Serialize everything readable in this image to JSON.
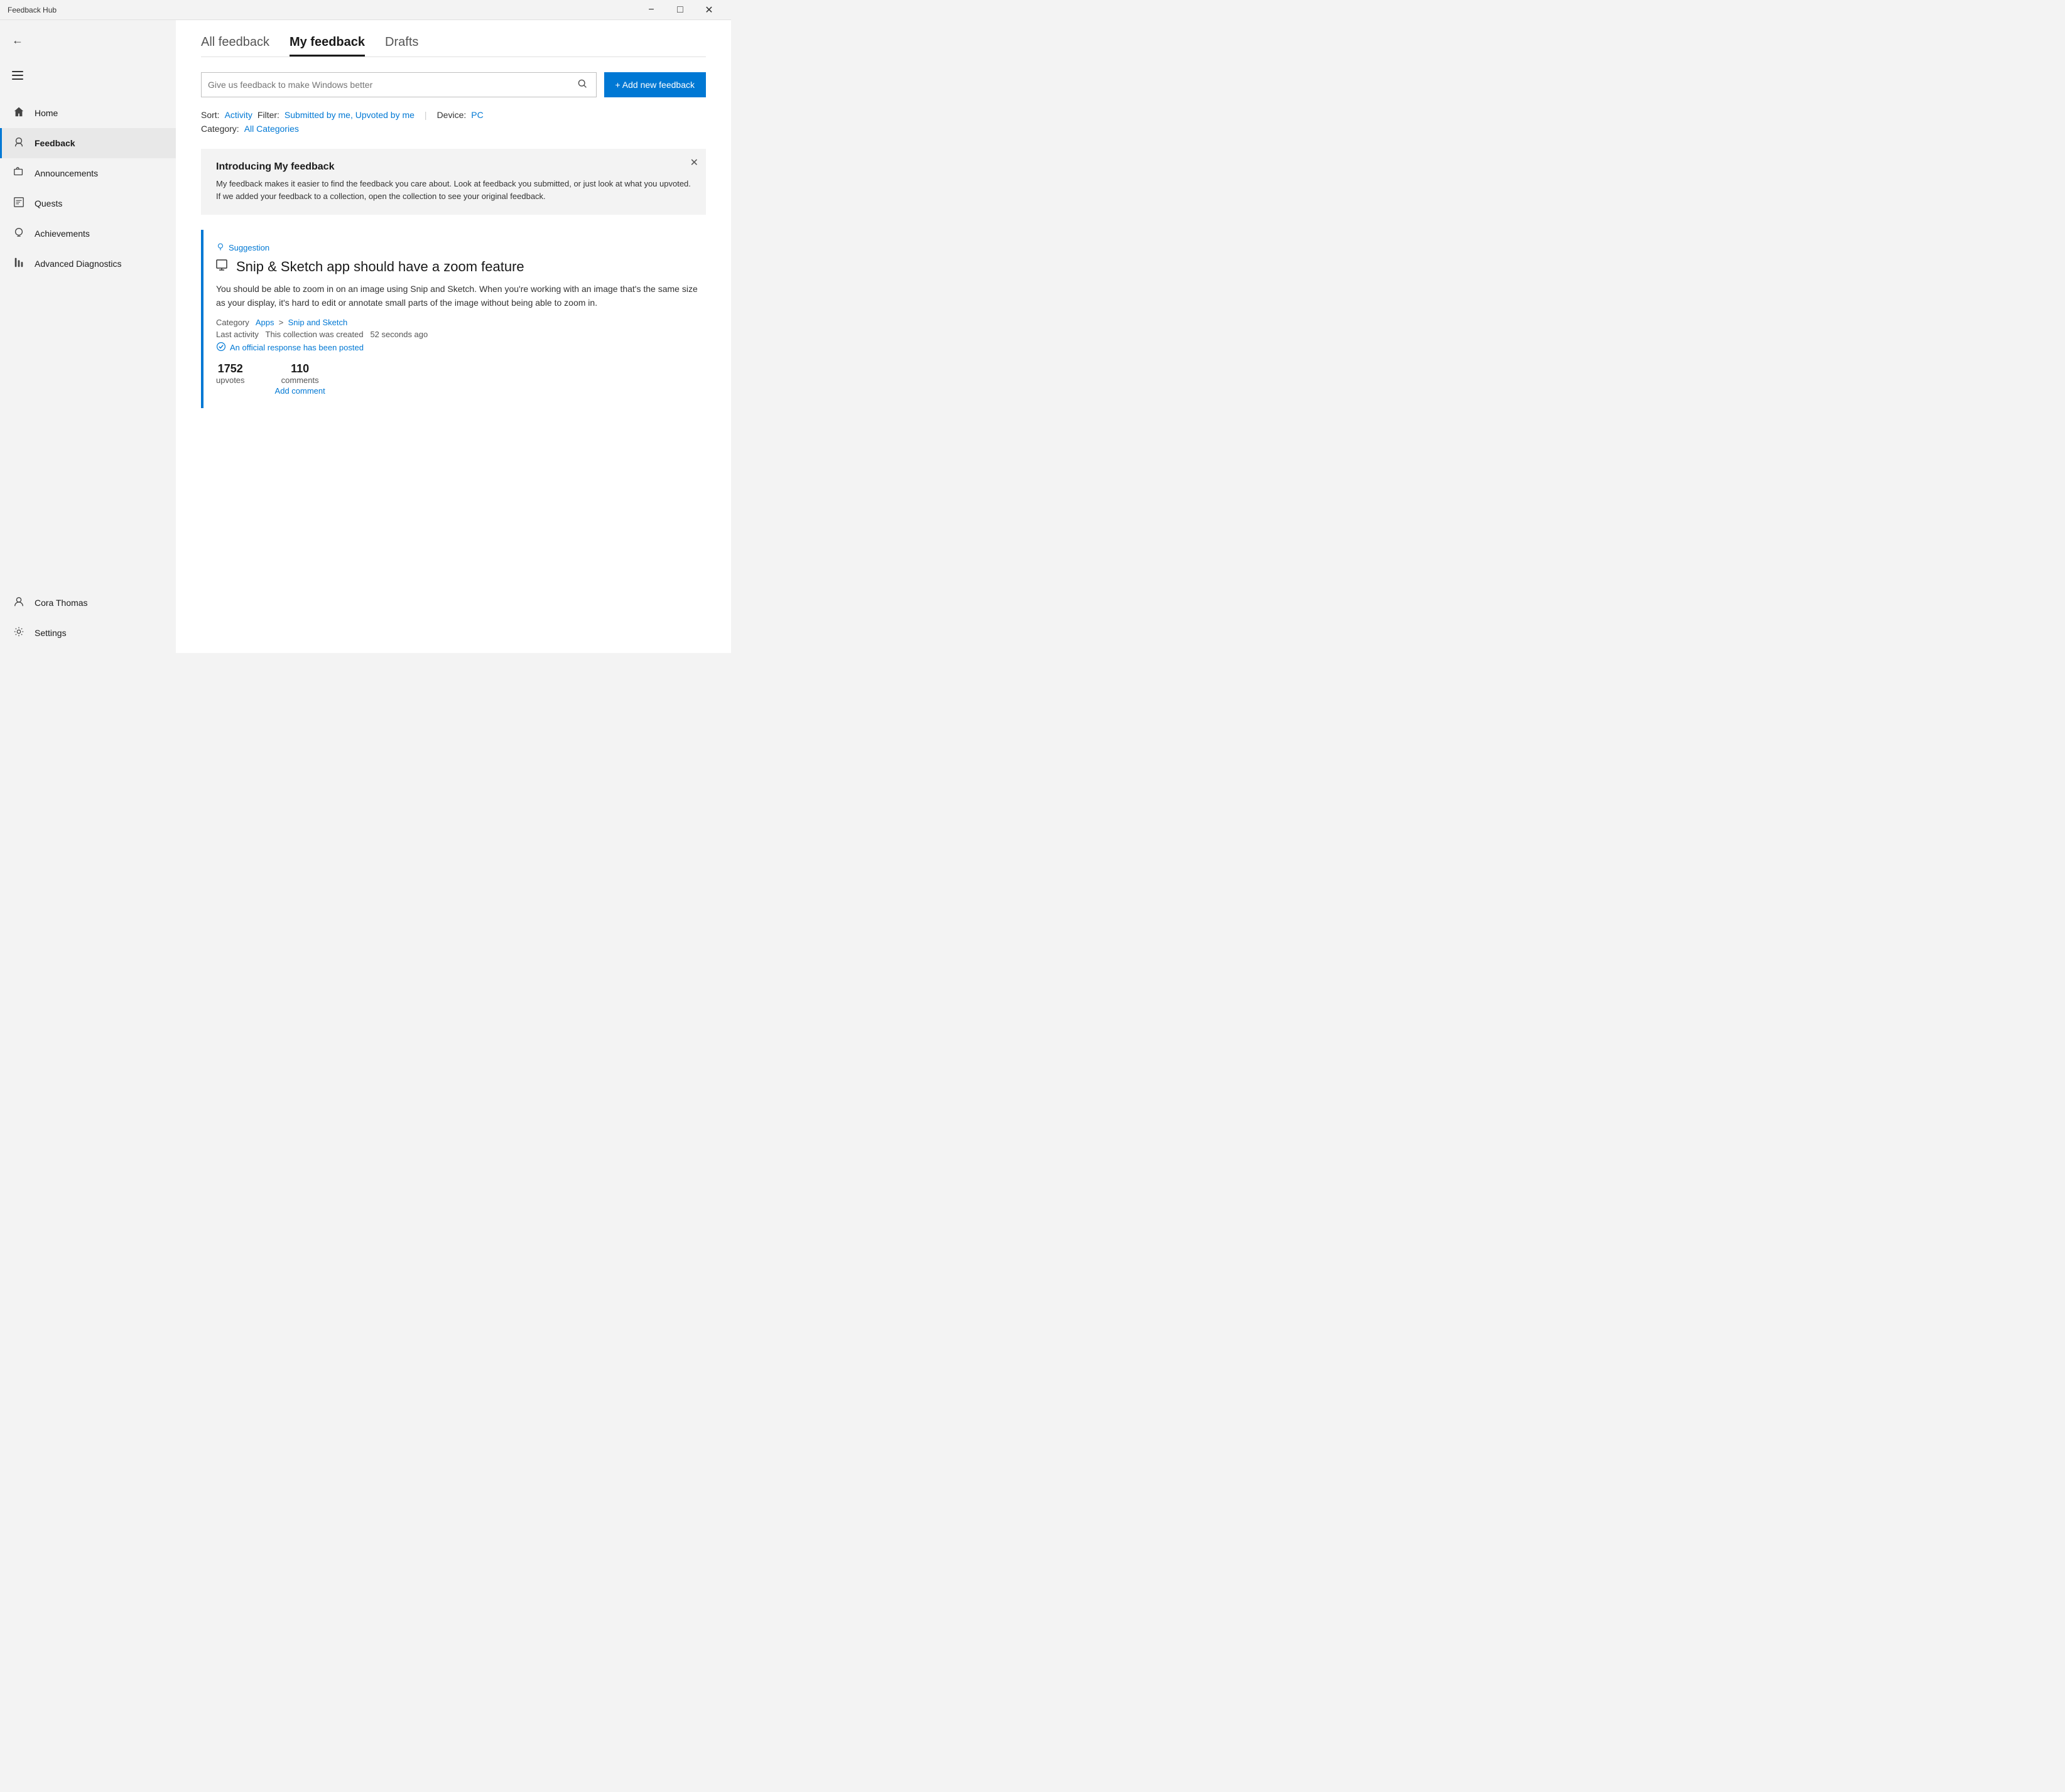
{
  "titlebar": {
    "title": "Feedback Hub",
    "minimize_label": "−",
    "maximize_label": "□",
    "close_label": "✕"
  },
  "sidebar": {
    "back_tooltip": "Back",
    "items": [
      {
        "id": "home",
        "label": "Home",
        "icon": "⌂",
        "active": false
      },
      {
        "id": "feedback",
        "label": "Feedback",
        "icon": "👤",
        "active": true
      },
      {
        "id": "announcements",
        "label": "Announcements",
        "icon": "📢",
        "active": false
      },
      {
        "id": "quests",
        "label": "Quests",
        "icon": "🎯",
        "active": false
      },
      {
        "id": "achievements",
        "label": "Achievements",
        "icon": "🏆",
        "active": false
      },
      {
        "id": "advanced-diagnostics",
        "label": "Advanced Diagnostics",
        "icon": "📊",
        "active": false
      }
    ],
    "bottom_items": [
      {
        "id": "user",
        "label": "Cora Thomas",
        "icon": "👤"
      },
      {
        "id": "settings",
        "label": "Settings",
        "icon": "⚙"
      }
    ]
  },
  "tabs": [
    {
      "id": "all-feedback",
      "label": "All feedback",
      "active": false
    },
    {
      "id": "my-feedback",
      "label": "My feedback",
      "active": true
    },
    {
      "id": "drafts",
      "label": "Drafts",
      "active": false
    }
  ],
  "search": {
    "placeholder": "Give us feedback to make Windows better"
  },
  "add_button": {
    "label": "+ Add new feedback"
  },
  "filters": {
    "sort_label": "Sort:",
    "sort_value": "Activity",
    "filter_label": "Filter:",
    "filter_value": "Submitted by me, Upvoted by me",
    "device_label": "Device:",
    "device_value": "PC",
    "category_label": "Category:",
    "category_value": "All Categories"
  },
  "intro_banner": {
    "title": "Introducing My feedback",
    "text": "My feedback makes it easier to find the feedback you care about. Look at feedback you submitted, or just look at what you upvoted. If we added your feedback to a collection, open the collection to see your original feedback."
  },
  "feedback_item": {
    "tag": "Suggestion",
    "title": "Snip & Sketch app should have a zoom feature",
    "app_icon": "🖥",
    "description": "You should be able to zoom in on an image using Snip and Sketch. When you're working with an image that's the same size as your display, it's hard to edit or annotate small parts of the image without being able to zoom in.",
    "category_label": "Category",
    "category_app": "Apps",
    "category_separator": ">",
    "category_sub": "Snip and Sketch",
    "last_activity_label": "Last activity",
    "last_activity_value": "This collection was created",
    "last_activity_time": "52 seconds ago",
    "official_response": "An official response has been posted",
    "upvotes_count": "1752",
    "upvotes_label": "upvotes",
    "comments_count": "110",
    "comments_label": "comments",
    "add_comment_label": "Add comment"
  }
}
